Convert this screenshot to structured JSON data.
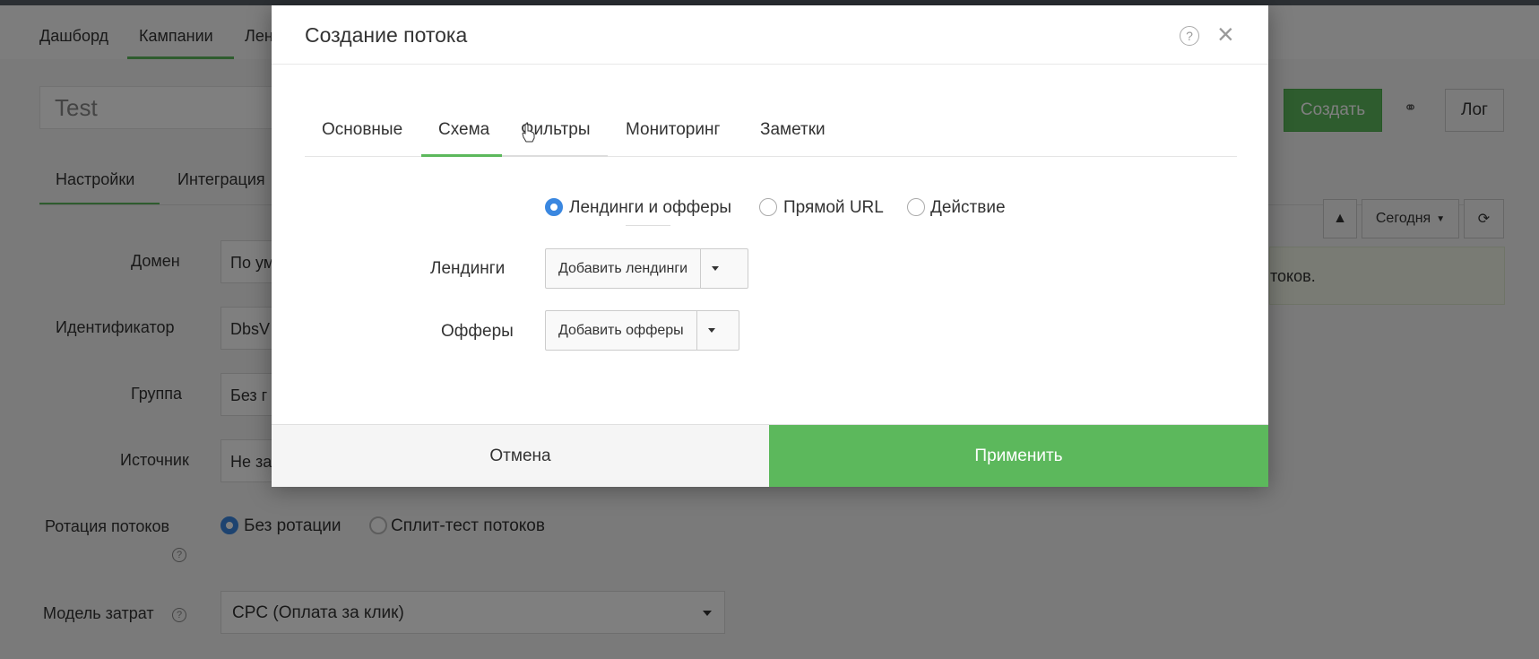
{
  "background": {
    "nav": [
      "Дашборд",
      "Кампании",
      "Лен"
    ],
    "campaign_name": "Test",
    "create_button": "Создать",
    "log_button": "Лог",
    "tabs": [
      "Настройки",
      "Интеграция"
    ],
    "period_button": "Сегодня",
    "alert_text": "токов.",
    "fields": {
      "domain_label": "Домен",
      "domain_value": "По ум",
      "identifier_label": "Идентификатор",
      "identifier_value": "DbsV",
      "group_label": "Группа",
      "group_value": "Без г",
      "source_label": "Источник",
      "source_value": "Не за"
    },
    "rotation": {
      "label": "Ротация потоков",
      "option_none": "Без ротации",
      "option_split": "Сплит-тест потоков",
      "selected": "Без ротации"
    },
    "cost_model": {
      "label": "Модель затрат",
      "value": "CPC (Оплата за клик)"
    }
  },
  "modal": {
    "title": "Создание потока",
    "tabs": [
      {
        "label": "Основные"
      },
      {
        "label": "Схема"
      },
      {
        "label": "Фильтры"
      },
      {
        "label": "Мониторинг"
      },
      {
        "label": "Заметки"
      }
    ],
    "active_tab": "Схема",
    "schema_options": {
      "landings_offers": "Лендинги и офферы",
      "direct_url": "Прямой URL",
      "action": "Действие",
      "selected": "Лендинги и офферы"
    },
    "landings": {
      "label": "Лендинги",
      "button": "Добавить лендинги"
    },
    "offers": {
      "label": "Офферы",
      "button": "Добавить офферы"
    },
    "footer": {
      "cancel": "Отмена",
      "apply": "Применить"
    }
  },
  "colors": {
    "accent_green": "#5cb85c",
    "radio_blue": "#3a87e0"
  },
  "icons": {
    "help": "help-circle-icon",
    "close": "close-icon",
    "cursor": "hand-pointer-icon"
  }
}
